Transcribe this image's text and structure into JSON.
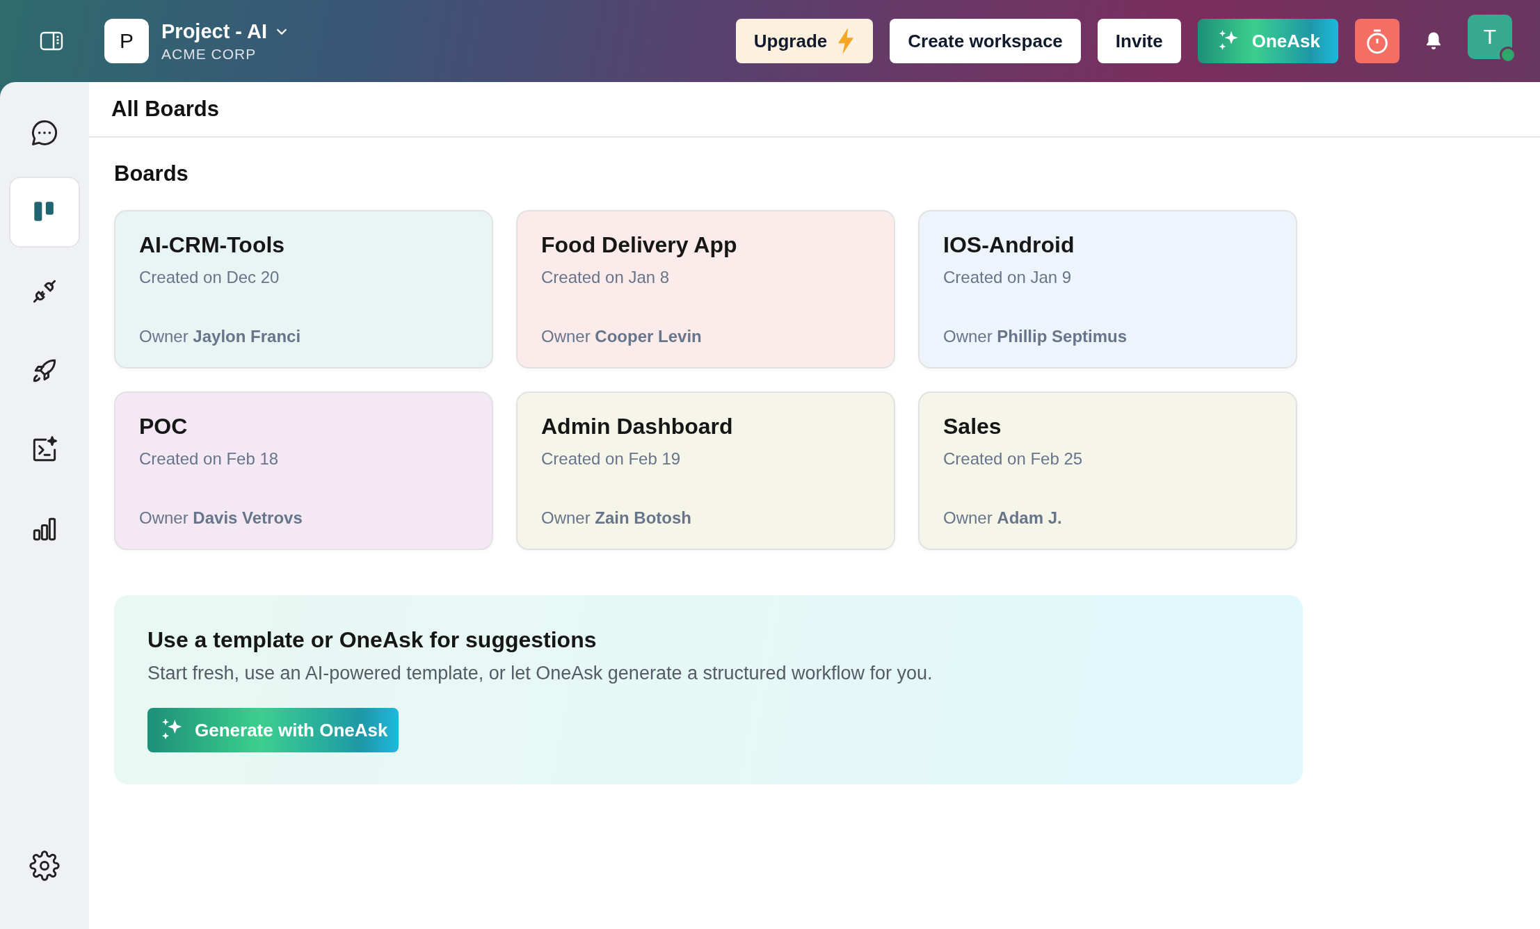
{
  "header": {
    "workspace": {
      "initial": "P",
      "name": "Project - AI",
      "org": "ACME CORP"
    },
    "buttons": [
      {
        "kind": "upgrade",
        "label": "Upgrade"
      },
      {
        "kind": "plain",
        "label": "Create workspace"
      },
      {
        "kind": "plain",
        "label": "Invite"
      },
      {
        "kind": "ai",
        "label": "OneAsk"
      }
    ],
    "avatar": {
      "initial": "T",
      "online": true
    }
  },
  "sidebar": {
    "items": [
      {
        "selected": false
      },
      {
        "selected": true
      },
      {
        "selected": false
      },
      {
        "selected": false
      },
      {
        "selected": false
      },
      {
        "selected": false
      }
    ]
  },
  "page_title": "All Boards",
  "section_title": "Boards",
  "boards": [
    {
      "name": "AI-CRM-Tools",
      "created": "Created on Dec 20",
      "owner": "Owner **Jaylon Franci**",
      "color": "#e9f5f4"
    },
    {
      "name": "Food Delivery App",
      "created": "Created on Jan 8",
      "owner": "Owner **Cooper Levin**",
      "color": "#fbeceb"
    },
    {
      "name": "IOS-Android",
      "created": "Created on Jan 9",
      "owner": "Owner **Phillip Septimus**",
      "color": "#edf4fc"
    },
    {
      "name": "POC",
      "created": "Created on Feb 18",
      "owner": "Owner **Davis Vetrovs**",
      "color": "#f3e8f4"
    },
    {
      "name": "Admin Dashboard",
      "created": "Created on Feb 19",
      "owner": "Owner **Zain Botosh**",
      "color": "#f5f5e9"
    },
    {
      "name": "Sales",
      "created": "Created on Feb 25",
      "owner": "Owner **Adam J.**",
      "color": "#f5f5e9"
    }
  ],
  "suggestion": {
    "title": "Use a template or OneAsk for suggestions",
    "text": "Start fresh, use an AI-powered template, or let OneAsk generate a structured workflow for you.",
    "button": "Generate with OneAsk"
  }
}
